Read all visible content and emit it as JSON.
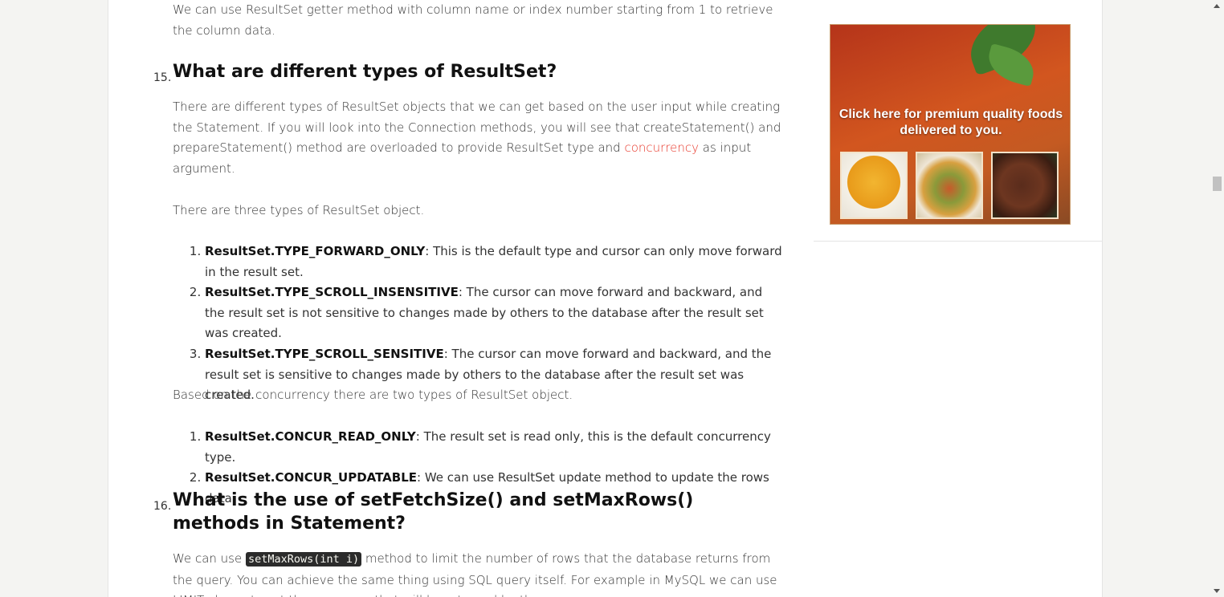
{
  "article": {
    "intro_text": "We can use ResultSet getter method with column name or index number starting from 1 to retrieve the column data.",
    "q15": {
      "number": "15.",
      "title": "What are different types of ResultSet?",
      "para1_a": "There are different types of ResultSet objects that we can get based on the user input while creating the Statement. If you will look into the Connection methods, you will see that createStatement() and prepareStatement() method are overloaded to provide ResultSet type and ",
      "para1_link": "concurrency",
      "para1_b": " as input argument.",
      "para2": "There are three types of ResultSet object.",
      "types": [
        {
          "name": "ResultSet.TYPE_FORWARD_ONLY",
          "desc": ": This is the default type and cursor can only move forward in the result set."
        },
        {
          "name": "ResultSet.TYPE_SCROLL_INSENSITIVE",
          "desc": ": The cursor can move forward and backward, and the result set is not sensitive to changes made by others to the database after the result set was created."
        },
        {
          "name": "ResultSet.TYPE_SCROLL_SENSITIVE",
          "desc": ": The cursor can move forward and backward, and the result set is sensitive to changes made by others to the database after the result set was created."
        }
      ],
      "para3": "Based on the concurrency there are two types of ResultSet object.",
      "concurrency": [
        {
          "name": "ResultSet.CONCUR_READ_ONLY",
          "desc": ": The result set is read only, this is the default concurrency type."
        },
        {
          "name": "ResultSet.CONCUR_UPDATABLE",
          "desc": ": We can use ResultSet update method to update the rows data."
        }
      ]
    },
    "q16": {
      "number": "16.",
      "title": "What is the use of setFetchSize() and setMaxRows() methods in Statement?",
      "para1_a": "We can use ",
      "para1_code": "setMaxRows(int i)",
      "para1_b": " method to limit the number of rows that the database returns from the query. You can achieve the same thing using SQL query itself. For example in MySQL we can use LIMIT clause to set the max rows that will be returned by the query."
    }
  },
  "sidebar": {
    "ad_text": "Click here for premium quality foods delivered to you."
  }
}
